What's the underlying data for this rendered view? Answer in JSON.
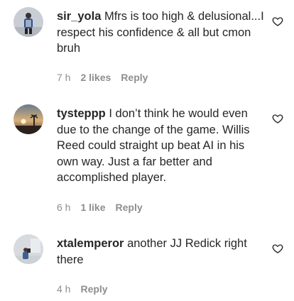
{
  "comments": [
    {
      "username": "sir_yola",
      "text": "Mfrs is too high & delusional...I respect his confidence & all but cmon bruh",
      "time": "7 h",
      "likes": "2 likes",
      "reply": "Reply"
    },
    {
      "username": "tysteppp",
      "text": "I don’t think he would even due to the change of the game. Willis Reed could straight up beat AI in his own way. Just a far better and accomplished player.",
      "time": "6 h",
      "likes": "1 like",
      "reply": "Reply"
    },
    {
      "username": "xtalemperor",
      "text": "another JJ Redick right there",
      "time": "4 h",
      "reply": "Reply"
    }
  ],
  "icons": {
    "like": "heart-outline-icon"
  },
  "colors": {
    "text": "#262626",
    "meta": "#8e8e8e"
  }
}
